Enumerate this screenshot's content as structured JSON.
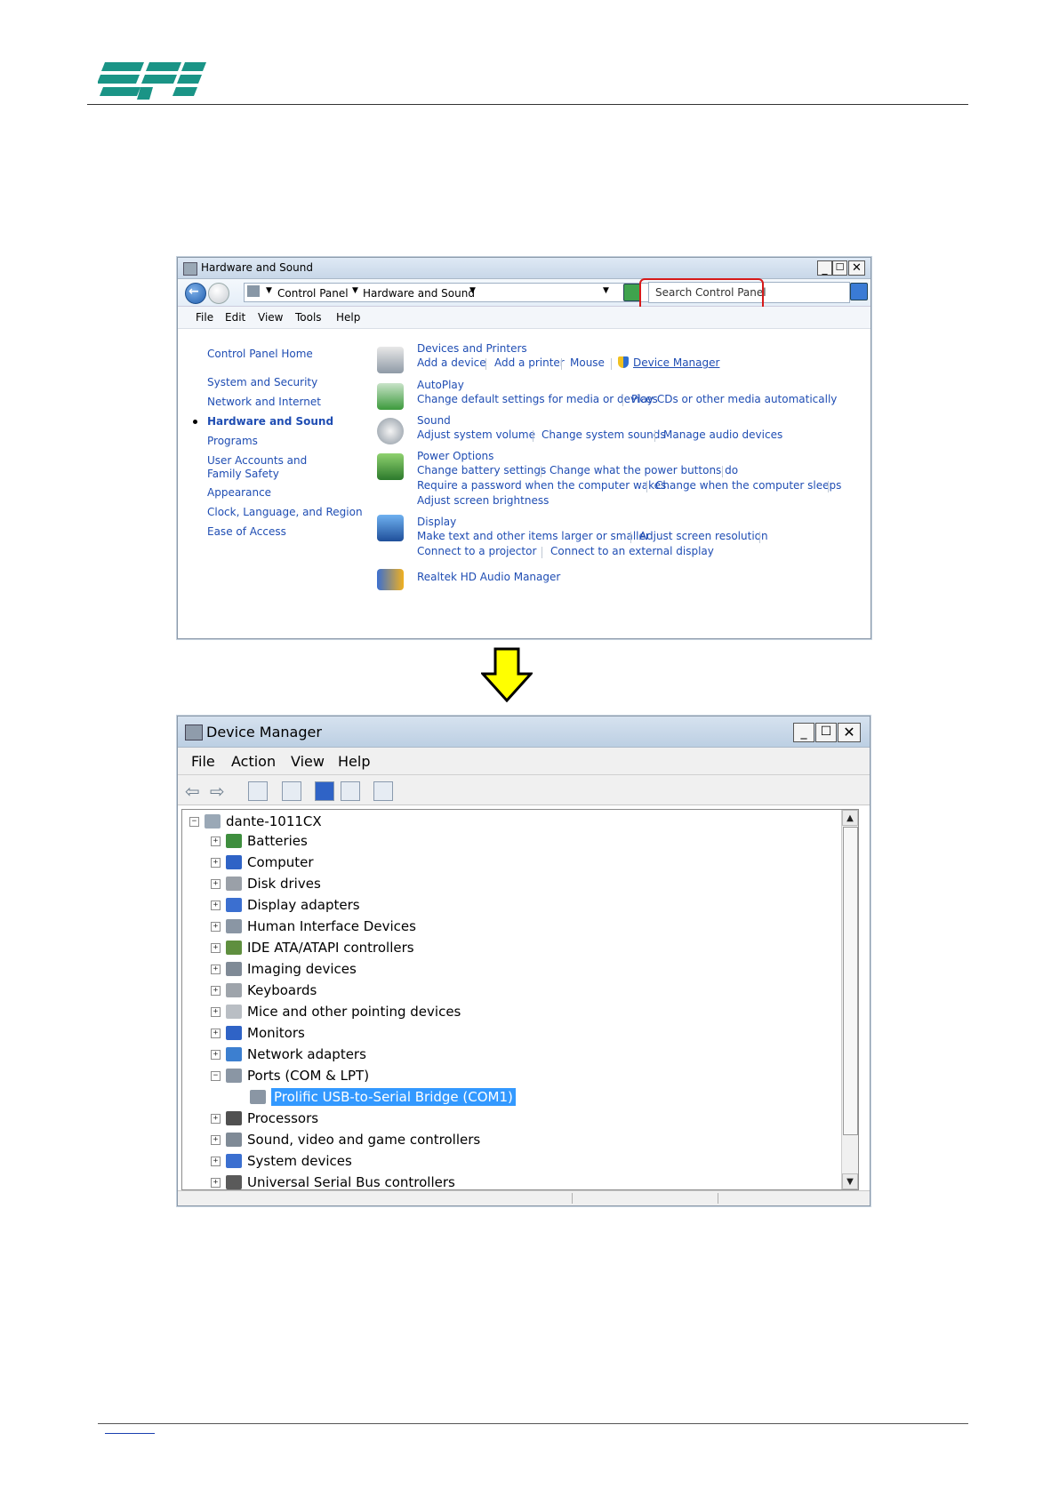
{
  "page": {
    "brand_color": "#1a9486"
  },
  "control_panel": {
    "title": "Hardware and Sound",
    "breadcrumb": [
      "Control Panel",
      "Hardware and Sound"
    ],
    "search_placeholder": "Search Control Panel",
    "menu": [
      "File",
      "Edit",
      "View",
      "Tools",
      "Help"
    ],
    "sidebar": {
      "items": [
        "Control Panel Home",
        "System and Security",
        "Network and Internet",
        "Hardware and Sound",
        "Programs",
        "User Accounts and Family Safety",
        "Appearance",
        "Clock, Language, and Region",
        "Ease of Access"
      ],
      "active": "Hardware and Sound"
    },
    "categories": [
      {
        "title": "Devices and Printers",
        "icon": "printer-icon",
        "links": [
          "Add a device",
          "Add a printer",
          "Mouse",
          "Device Manager"
        ]
      },
      {
        "title": "AutoPlay",
        "icon": "autoplay-icon",
        "links": [
          "Change default settings for media or devices",
          "Play CDs or other media automatically"
        ]
      },
      {
        "title": "Sound",
        "icon": "speaker-icon",
        "links": [
          "Adjust system volume",
          "Change system sounds",
          "Manage audio devices"
        ]
      },
      {
        "title": "Power Options",
        "icon": "power-icon",
        "links": [
          "Change battery settings",
          "Change what the power buttons do",
          "Require a password when the computer wakes",
          "Change when the computer sleeps",
          "Adjust screen brightness"
        ]
      },
      {
        "title": "Display",
        "icon": "display-icon",
        "links": [
          "Make text and other items larger or smaller",
          "Adjust screen resolution",
          "Connect to a projector",
          "Connect to an external display"
        ]
      },
      {
        "title": "Realtek HD Audio Manager",
        "icon": "realtek-icon",
        "links": []
      }
    ]
  },
  "device_manager": {
    "title": "Device Manager",
    "menu": [
      "File",
      "Action",
      "View",
      "Help"
    ],
    "root": "dante-1011CX",
    "nodes": [
      {
        "label": "Batteries",
        "icon": "battery-icon"
      },
      {
        "label": "Computer",
        "icon": "computer-icon"
      },
      {
        "label": "Disk drives",
        "icon": "disk-icon"
      },
      {
        "label": "Display adapters",
        "icon": "display-adapter-icon"
      },
      {
        "label": "Human Interface Devices",
        "icon": "hid-icon"
      },
      {
        "label": "IDE ATA/ATAPI controllers",
        "icon": "ide-icon"
      },
      {
        "label": "Imaging devices",
        "icon": "camera-icon"
      },
      {
        "label": "Keyboards",
        "icon": "keyboard-icon"
      },
      {
        "label": "Mice and other pointing devices",
        "icon": "mouse-icon"
      },
      {
        "label": "Monitors",
        "icon": "monitor-icon"
      },
      {
        "label": "Network adapters",
        "icon": "network-icon"
      },
      {
        "label": "Ports (COM & LPT)",
        "icon": "port-icon",
        "expanded": true
      },
      {
        "label": "Prolific USB-to-Serial Bridge (COM1)",
        "icon": "serial-port-icon",
        "child": true,
        "selected": true
      },
      {
        "label": "Processors",
        "icon": "processor-icon"
      },
      {
        "label": "Sound, video and game controllers",
        "icon": "sound-icon"
      },
      {
        "label": "System devices",
        "icon": "system-icon"
      },
      {
        "label": "Universal Serial Bus controllers",
        "icon": "usb-icon"
      }
    ]
  }
}
